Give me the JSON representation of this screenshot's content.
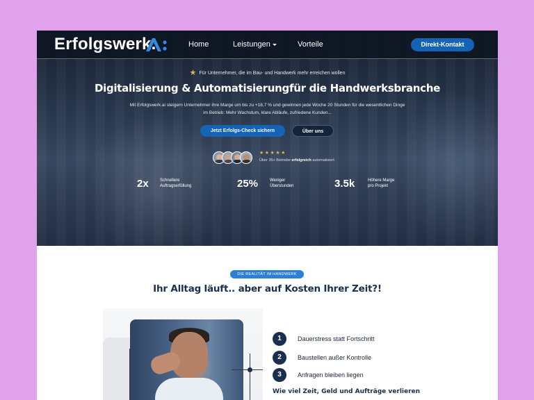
{
  "nav": {
    "logo_text": "Erfolgswerk.",
    "logo_mark": "A:",
    "links": [
      "Home",
      "Leistungen",
      "Vorteile"
    ],
    "cta": "Direkt-Kontakt"
  },
  "hero": {
    "tagline": "Für Unternehmer, die im Bau- und Handwerk mehr erreichen wollen",
    "title": "Digitalisierung & Automatisierungfür die Handwerksbranche",
    "description": "Mit Erfolgswerk.ai steigern Unternehmer ihre Marge um bis zu +18,7 % und gewinnen jede Woche 20 Stunden für die wesentlichen Dinge im Betrieb: Mehr Wachstum, klare Abläufe, zufriedene Kunden...",
    "primary_button": "Jetzt Erfolgs-Check sichern",
    "secondary_button": "Über uns",
    "stars": "★★★★★",
    "rating_prefix": "Über 35+ Betriebe ",
    "rating_bold": "erfolgreich",
    "rating_suffix": " automatisiert",
    "stats": [
      {
        "value": "2x",
        "label_line1": "Schnellere",
        "label_line2": "Auftragserfüllung"
      },
      {
        "value": "25%",
        "label_line1": "Weniger",
        "label_line2": "Überstunden"
      },
      {
        "value": "3.5k",
        "label_line1": "Höhere Marge",
        "label_line2": "pro Projekt"
      }
    ]
  },
  "section": {
    "badge": "DIE REALITÄT IM HANDWERK",
    "title": "Ihr Alltag läuft.. aber auf Kosten Ihrer Zeit?!",
    "steps": [
      {
        "num": "1",
        "text": "Dauerstress statt Fortschritt"
      },
      {
        "num": "2",
        "text": "Baustellen außer Kontrolle"
      },
      {
        "num": "3",
        "text": "Anfragen bleiben liegen"
      }
    ],
    "question": "Wie viel Zeit, Geld und Aufträge verlieren"
  },
  "colors": {
    "accent": "#1463b5",
    "navy": "#1a2f4d",
    "background": "#e0a2ea"
  }
}
